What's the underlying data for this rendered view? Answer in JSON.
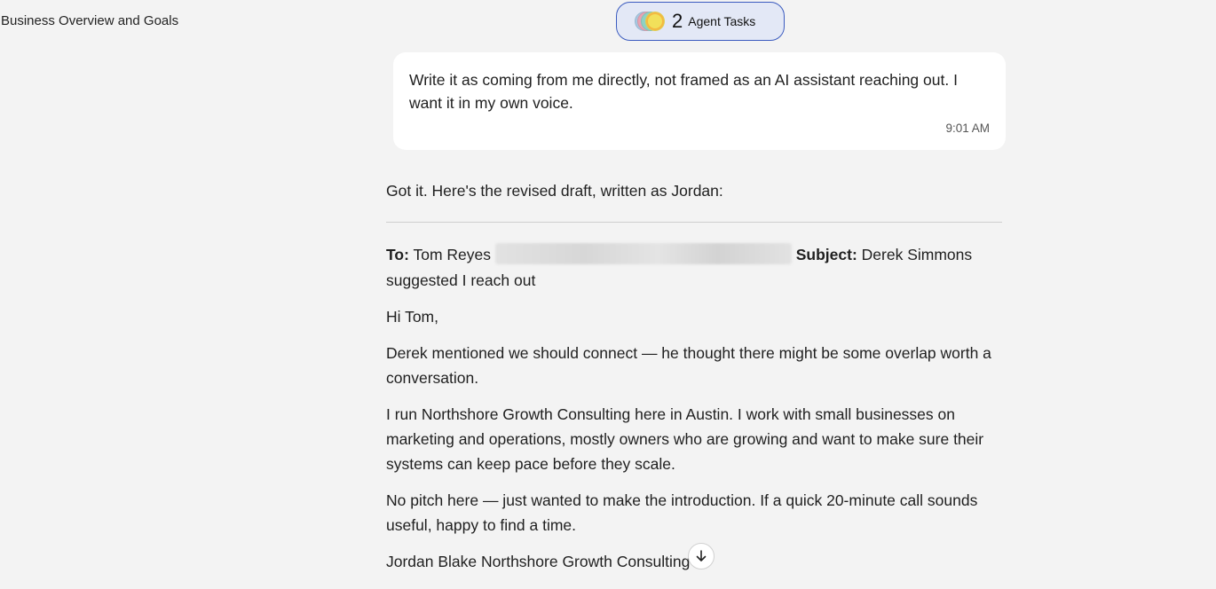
{
  "page_title": "Business Overview and Goals",
  "agent_tasks": {
    "count": "2",
    "label": "Agent Tasks"
  },
  "user_message": {
    "text": "Write it as coming from me directly, not framed as an AI assistant reaching out. I want it in my own voice.",
    "time": "9:01 AM"
  },
  "assistant_reply": {
    "intro": "Got it. Here's the revised draft, written as Jordan:",
    "email": {
      "to_label": "To:",
      "to_name": "Tom Reyes",
      "subject_label": "Subject:",
      "subject": "Derek Simmons suggested I reach out",
      "greeting": "Hi Tom,",
      "para1": "Derek mentioned we should connect — he thought there might be some overlap worth a conversation.",
      "para2": "I run Northshore Growth Consulting here in Austin. I work with small businesses on marketing and operations, mostly owners who are growing and want to make sure their systems can keep pace before they scale.",
      "para3": "No pitch here — just wanted to make the introduction. If a quick 20-minute call sounds useful, happy to find a time.",
      "signature": "Jordan Blake Northshore Growth Consulting"
    }
  },
  "icons": {
    "scroll_down": "arrow-down-icon"
  }
}
